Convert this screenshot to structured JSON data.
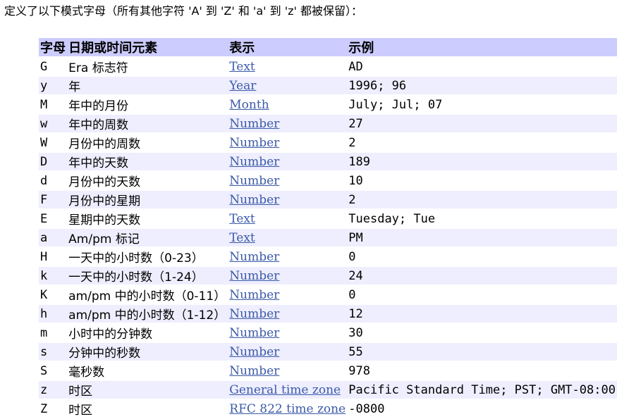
{
  "intro": "定义了以下模式字母（所有其他字符 'A' 到 'Z' 和 'a' 到 'z' 都被保留）：",
  "table": {
    "headers": {
      "letter": "字母",
      "element": "日期或时间元素",
      "presentation": "表示",
      "examples": "示例"
    },
    "rows": [
      {
        "letter": "G",
        "element": "Era 标志符",
        "presentation": "Text",
        "examples": "AD"
      },
      {
        "letter": "y",
        "element": "年",
        "presentation": "Year",
        "examples": "1996; 96"
      },
      {
        "letter": "M",
        "element": "年中的月份",
        "presentation": "Month",
        "examples": "July; Jul; 07"
      },
      {
        "letter": "w",
        "element": "年中的周数",
        "presentation": "Number",
        "examples": "27"
      },
      {
        "letter": "W",
        "element": "月份中的周数",
        "presentation": "Number",
        "examples": "2"
      },
      {
        "letter": "D",
        "element": "年中的天数",
        "presentation": "Number",
        "examples": "189"
      },
      {
        "letter": "d",
        "element": "月份中的天数",
        "presentation": "Number",
        "examples": "10"
      },
      {
        "letter": "F",
        "element": "月份中的星期",
        "presentation": "Number",
        "examples": "2"
      },
      {
        "letter": "E",
        "element": "星期中的天数",
        "presentation": "Text",
        "examples": "Tuesday; Tue"
      },
      {
        "letter": "a",
        "element": "Am/pm 标记",
        "presentation": "Text",
        "examples": "PM"
      },
      {
        "letter": "H",
        "element": "一天中的小时数（0-23）",
        "presentation": "Number",
        "examples": "0"
      },
      {
        "letter": "k",
        "element": "一天中的小时数（1-24）",
        "presentation": "Number",
        "examples": "24"
      },
      {
        "letter": "K",
        "element": "am/pm 中的小时数（0-11）",
        "presentation": "Number",
        "examples": "0"
      },
      {
        "letter": "h",
        "element": "am/pm 中的小时数（1-12）",
        "presentation": "Number",
        "examples": "12"
      },
      {
        "letter": "m",
        "element": "小时中的分钟数",
        "presentation": "Number",
        "examples": "30"
      },
      {
        "letter": "s",
        "element": "分钟中的秒数",
        "presentation": "Number",
        "examples": "55"
      },
      {
        "letter": "S",
        "element": "毫秒数",
        "presentation": "Number",
        "examples": "978"
      },
      {
        "letter": "z",
        "element": "时区",
        "presentation": "General time zone",
        "examples": "Pacific Standard Time; PST; GMT-08:00"
      },
      {
        "letter": "Z",
        "element": "时区",
        "presentation": "RFC 822 time zone",
        "examples": "-0800"
      }
    ]
  },
  "colors": {
    "header_bg": "#ccccff",
    "stripe_bg": "#eeeeff",
    "link": "#3b5aa8"
  }
}
